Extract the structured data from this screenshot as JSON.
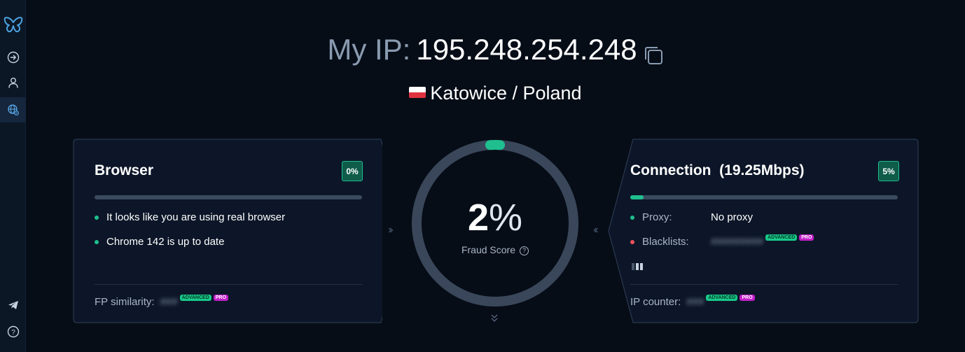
{
  "sidebar": {
    "logo_icon": "butterfly-icon",
    "items": [
      {
        "icon": "arrow-right-circle-icon"
      },
      {
        "icon": "user-icon"
      },
      {
        "icon": "globe-settings-icon",
        "active": true
      }
    ],
    "bottom_items": [
      {
        "icon": "telegram-icon"
      },
      {
        "icon": "help-icon"
      }
    ]
  },
  "header": {
    "ip_label": "My IP:",
    "ip_value": "195.248.254.248",
    "location": "Katowice / Poland"
  },
  "browser": {
    "title": "Browser",
    "badge": "0%",
    "progress": 0,
    "items": [
      {
        "text": "It looks like you are using real browser",
        "status": "green"
      },
      {
        "text": "Chrome 142 is up to date",
        "status": "green"
      }
    ],
    "fp_label": "FP similarity:",
    "fp_value": "###",
    "tag_advanced": "ADVANCED",
    "tag_pro": "PRO"
  },
  "gauge": {
    "score": "2",
    "percent_sign": "%",
    "label": "Fraud Score",
    "help": "?",
    "value": 0.02
  },
  "connection": {
    "title": "Connection",
    "speed": "(19.25Mbps)",
    "badge": "5%",
    "progress": 0.05,
    "proxy_label": "Proxy:",
    "proxy_value": "No proxy",
    "blacklists_label": "Blacklists:",
    "blacklists_value": "#########",
    "ip_counter_label": "IP counter:",
    "ip_counter_value": "###",
    "tag_advanced": "ADVANCED",
    "tag_pro": "PRO"
  },
  "colors": {
    "accent": "#1fbf8f",
    "danger": "#f0525f",
    "pro": "#c21fc8",
    "background": "#060d17",
    "panel": "#0c1628"
  }
}
